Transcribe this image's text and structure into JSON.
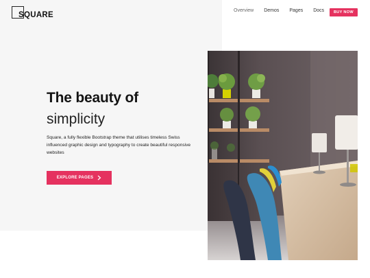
{
  "brand": {
    "name": "SQUARE"
  },
  "nav": {
    "items": [
      "Overview",
      "Demos",
      "Pages",
      "Docs"
    ],
    "cta": "BUY NOW"
  },
  "hero": {
    "title_line1": "The beauty of",
    "title_line2": "simplicity",
    "description": "Square, a fully flexible Bootstrap theme that utilises timeless Swiss influenced graphic design and typography to create beautiful responsive websites",
    "cta_label": "EXPLORE PAGES"
  },
  "colors": {
    "accent": "#e5325f",
    "hero_bg": "#f6f6f6"
  },
  "icons": {
    "cta_arrow": "chevron-right-icon"
  }
}
